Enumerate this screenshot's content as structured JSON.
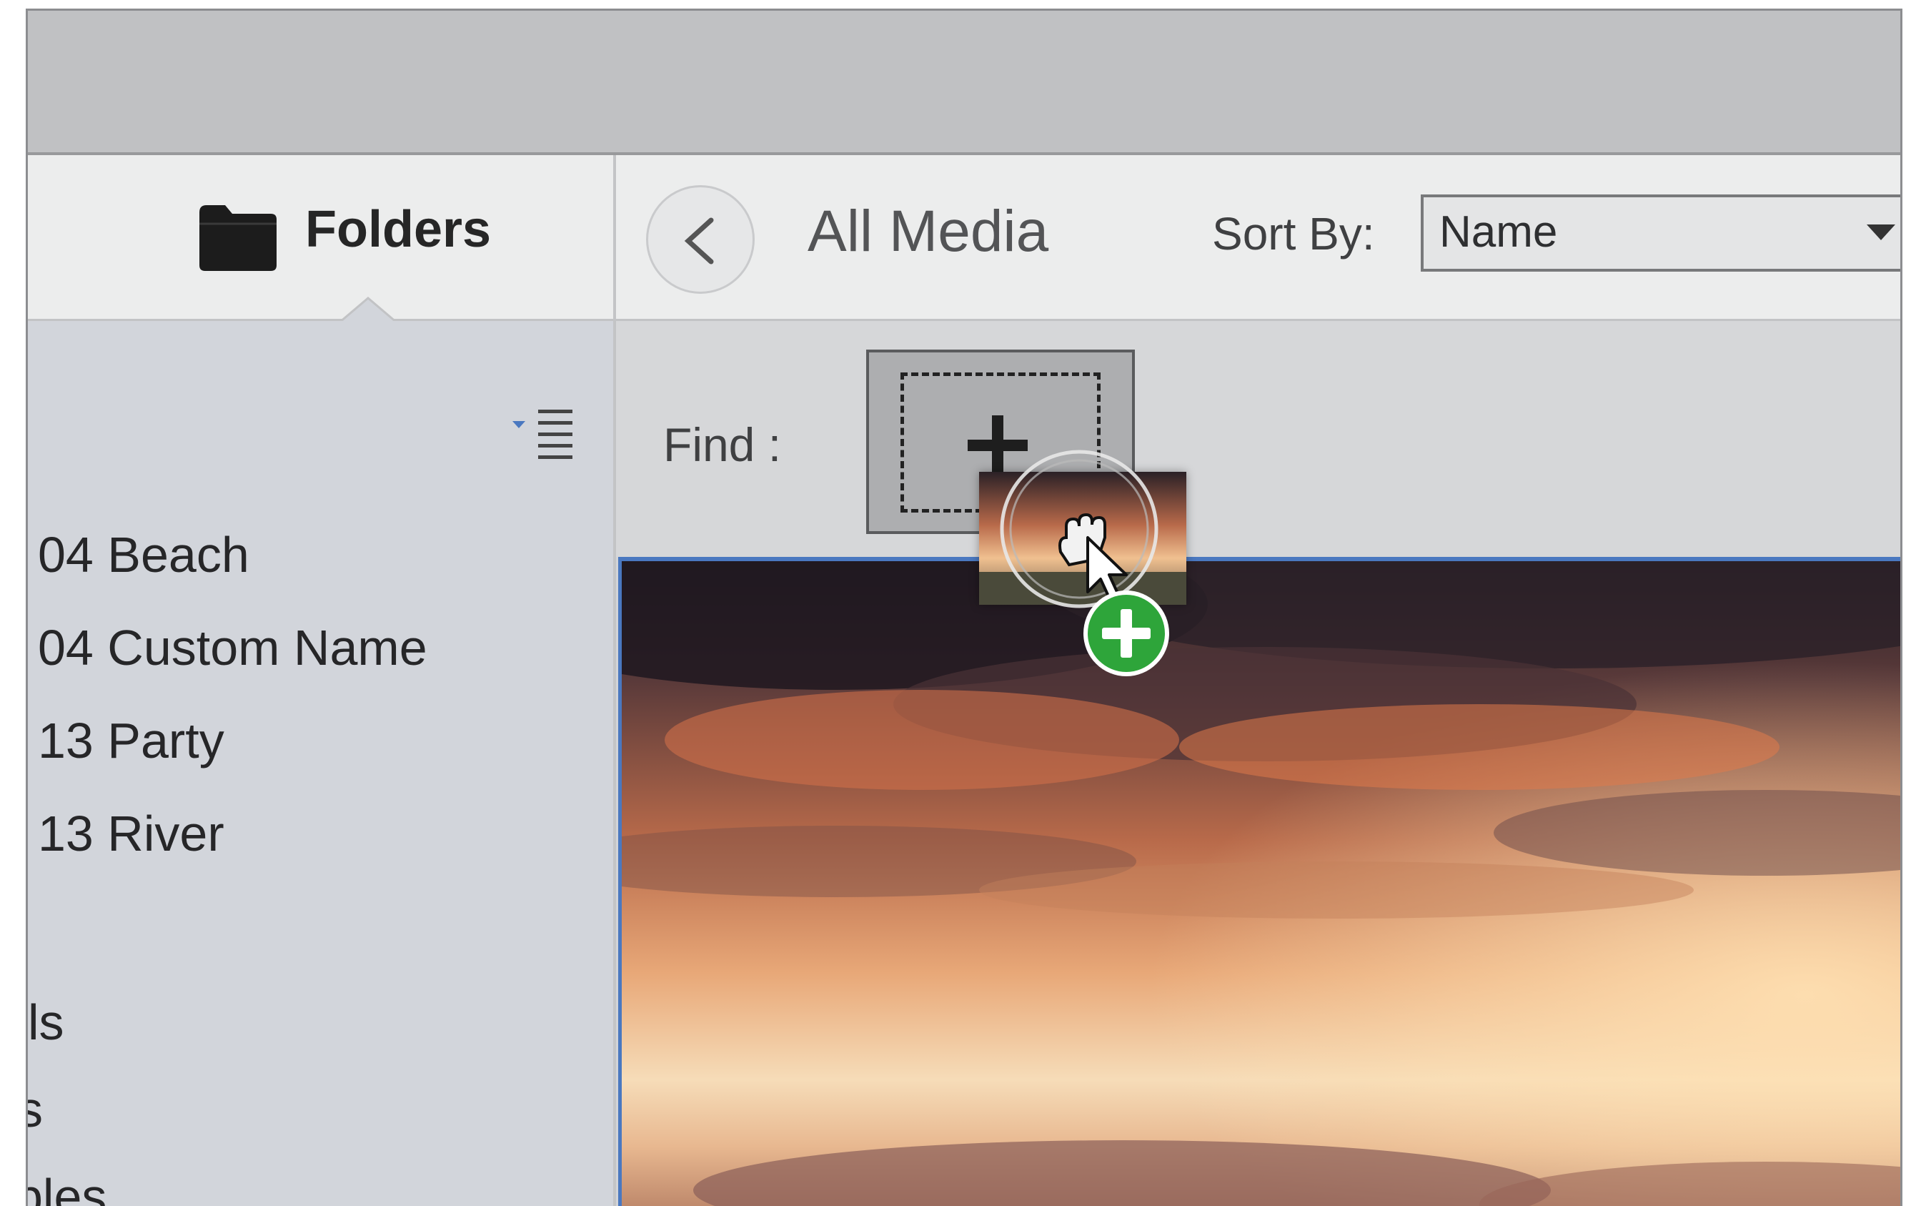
{
  "sidebar": {
    "tab_label": "Folders",
    "items": [
      {
        "label": "04 Beach"
      },
      {
        "label": "04 Custom Name"
      },
      {
        "label": "13 Party"
      },
      {
        "label": "13 River"
      },
      {
        "label": "ls"
      },
      {
        "label": "s"
      },
      {
        "label": "ples"
      }
    ]
  },
  "header": {
    "title": "All Media",
    "sort_label": "Sort By:",
    "sort_value": "Name"
  },
  "find": {
    "label": "Find :"
  },
  "icons": {
    "folder": "folder-icon",
    "back": "chevron-left-icon",
    "list_options": "list-options-icon",
    "add": "plus-icon",
    "drag_add": "green-plus-badge-icon",
    "cursor": "grab-hand-cursor-icon"
  },
  "colors": {
    "selection_border": "#4a78c0",
    "add_badge": "#2ea53a"
  }
}
